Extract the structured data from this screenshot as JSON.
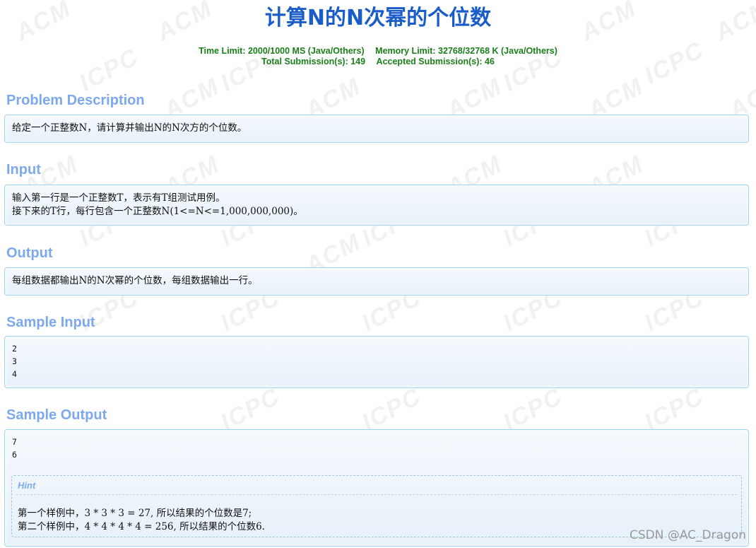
{
  "page": {
    "title": "计算N的N次幂的个位数",
    "time_limit": "Time Limit: 2000/1000 MS (Java/Others)",
    "memory_limit": "Memory Limit: 32768/32768 K (Java/Others)",
    "total_submissions": "Total Submission(s): 149",
    "accepted_submissions": "Accepted Submission(s): 46"
  },
  "sections": {
    "description": {
      "heading": "Problem Description",
      "lines": [
        "给定一个正整数N，请计算并输出N的N次方的个位数。"
      ]
    },
    "input": {
      "heading": "Input",
      "lines": [
        "输入第一行是一个正整数T，表示有T组测试用例。",
        "接下来的T行，每行包含一个正整数N(1<=N<=1,000,000,000)。"
      ]
    },
    "output": {
      "heading": "Output",
      "lines": [
        "每组数据都输出N的N次幂的个位数，每组数据输出一行。"
      ]
    },
    "sample_input": {
      "heading": "Sample Input",
      "lines": [
        "2",
        "3",
        "4"
      ]
    },
    "sample_output": {
      "heading": "Sample Output",
      "lines": [
        "7",
        "6"
      ]
    },
    "hint": {
      "label": "Hint",
      "lines": [
        "第一个样例中，3 * 3 * 3 = 27, 所以结果的个位数是7;",
        "第二个样例中，4 * 4 * 4 * 4 = 256, 所以结果的个位数6."
      ]
    }
  },
  "watermark_text": "CSDN @AC_Dragon",
  "background_watermarks": [
    "ACM",
    "ICPC"
  ],
  "colors": {
    "title": "#1a5cc8",
    "limits": "#1a7f1a",
    "heading": "#7ca9ed",
    "box_border": "#9fd3ef"
  }
}
